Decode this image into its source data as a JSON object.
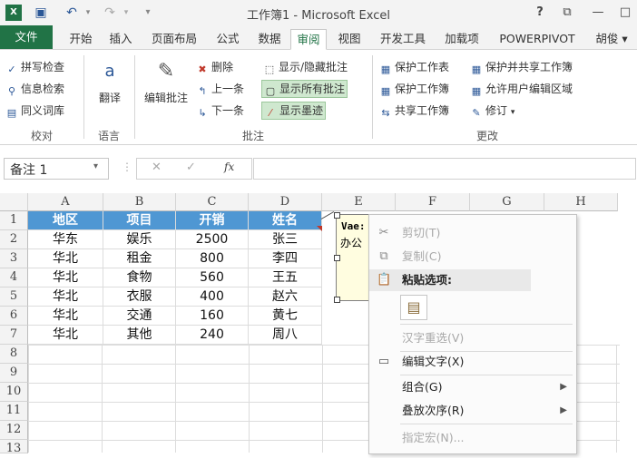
{
  "window": {
    "title": "工作簿1 - Microsoft Excel",
    "controls": {
      "help": "?",
      "restore": "⧉",
      "minimize": "—"
    }
  },
  "quick_access": {
    "undo": "↶",
    "redo": "↷",
    "more": "▾"
  },
  "tabs": [
    {
      "label": "文件"
    },
    {
      "label": "开始"
    },
    {
      "label": "插入"
    },
    {
      "label": "页面布局"
    },
    {
      "label": "公式"
    },
    {
      "label": "数据"
    },
    {
      "label": "审阅"
    },
    {
      "label": "视图"
    },
    {
      "label": "开发工具"
    },
    {
      "label": "加载项"
    },
    {
      "label": "POWERPIVOT"
    },
    {
      "label": "胡俊 ▾"
    }
  ],
  "ribbon": {
    "proofing": {
      "spell": "拼写检查",
      "research": "信息检索",
      "thesaurus": "同义词库",
      "label": "校对"
    },
    "language": {
      "translate_line1": "a",
      "translate": "翻译",
      "label": "语言"
    },
    "comments": {
      "edit": "编辑批注",
      "delete": "删除",
      "prev": "上一条",
      "next": "下一条",
      "show_hide": "显示/隐藏批注",
      "show_all": "显示所有批注",
      "show_ink": "显示墨迹",
      "label": "批注"
    },
    "changes": {
      "protect_sheet": "保护工作表",
      "protect_workbook": "保护工作簿",
      "share_workbook": "共享工作簿",
      "protect_share": "保护并共享工作簿",
      "allow_edit": "允许用户编辑区域",
      "track": "修订",
      "track_arrow": "▾",
      "label": "更改"
    }
  },
  "formula_bar": {
    "name_box": "备注 1",
    "fx": "fx",
    "cancel": "✕",
    "enter": "✓",
    "dropdown": "▾"
  },
  "sheet": {
    "columns": [
      "A",
      "B",
      "C",
      "D",
      "E",
      "F",
      "G",
      "H"
    ],
    "rows": [
      "1",
      "2",
      "3",
      "4",
      "5",
      "6",
      "7",
      "8",
      "9",
      "10",
      "11",
      "12",
      "13"
    ],
    "header": [
      "地区",
      "项目",
      "开销",
      "姓名"
    ],
    "data": [
      [
        "华东",
        "娱乐",
        "2500",
        "张三"
      ],
      [
        "华北",
        "租金",
        "800",
        "李四"
      ],
      [
        "华北",
        "食物",
        "560",
        "王五"
      ],
      [
        "华北",
        "衣服",
        "400",
        "赵六"
      ],
      [
        "华北",
        "交通",
        "160",
        "黄七"
      ],
      [
        "华北",
        "其他",
        "240",
        "周八"
      ]
    ],
    "header_color": "#4f97d3"
  },
  "comment": {
    "author": "Vae:",
    "text": "办公"
  },
  "context_menu": {
    "cut": "剪切(T)",
    "copy": "复制(C)",
    "paste_options": "粘贴选项:",
    "reconvert": "汉字重选(V)",
    "edit_text": "编辑文字(X)",
    "group": "组合(G)",
    "order": "叠放次序(R)",
    "assign_macro": "指定宏(N)..."
  }
}
